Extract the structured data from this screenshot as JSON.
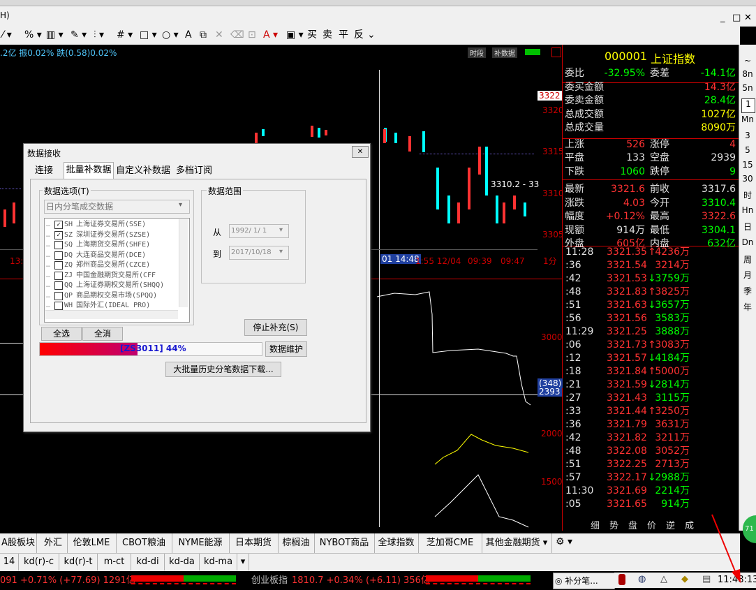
{
  "menubar": {
    "menu_fragment": "H)",
    "min_btn": "_",
    "restore_btn": "□",
    "close_btn": "✕"
  },
  "toolbar": {
    "icons": [
      "line-icon",
      "percent-icon",
      "grid-icon",
      "pen-icon",
      "align-icon",
      "hash-icon",
      "rect-icon",
      "circle-icon",
      "text-A-icon",
      "copy-icon",
      "delete-icon",
      "trash-icon",
      "font-color-icon",
      "save-icon"
    ],
    "buy_label": "买",
    "sell_label": "卖",
    "flat_label": "平",
    "reverse_label": "反",
    "more": "⌄"
  },
  "chart": {
    "header_text": ".2亿 振0.02% 跌(0.58)0.02%",
    "btn_time": "时段",
    "btn_fill": "补数据",
    "price_axis": [
      "3320",
      "3315",
      "3310",
      "3305"
    ],
    "price_tag": "3322",
    "annotation": "3310.2 - 33",
    "time_labels": [
      "13:",
      "01 14:48",
      "1:55 12/04",
      "09:39",
      "09:47",
      "1分"
    ],
    "vol_axis": [
      "3000",
      "2000",
      "1500"
    ],
    "vol_tag_top": "(348)",
    "vol_tag_bottom": "2393"
  },
  "quote": {
    "code": "000001",
    "name": "上证指数",
    "rows": [
      {
        "l1": "委比",
        "v1": "-32.95%",
        "l2": "委差",
        "v2": "-14.1亿",
        "c1": "#00ff00",
        "c2": "#00ff00"
      },
      {
        "l1": "委买金额",
        "v1": "",
        "l2": "",
        "v2": "14.3亿",
        "c1": "#ff3232",
        "c2": "#ff3232"
      },
      {
        "l1": "委卖金额",
        "v1": "",
        "l2": "",
        "v2": "28.4亿",
        "c1": "#00ff00",
        "c2": "#00ff00"
      },
      {
        "l1": "总成交额",
        "v1": "",
        "l2": "",
        "v2": "1027亿",
        "c1": "#ffff00",
        "c2": "#ffff00"
      },
      {
        "l1": "总成交量",
        "v1": "",
        "l2": "",
        "v2": "8090万",
        "c1": "#ffff00",
        "c2": "#ffff00"
      },
      {
        "l1": "上涨",
        "v1": "526",
        "l2": "涨停",
        "v2": "4",
        "c1": "#ff3232",
        "c2": "#ff3232"
      },
      {
        "l1": "平盘",
        "v1": "133",
        "l2": "空盘",
        "v2": "2939",
        "c1": "#e0e0e0",
        "c2": "#e0e0e0"
      },
      {
        "l1": "下跌",
        "v1": "1060",
        "l2": "跌停",
        "v2": "9",
        "c1": "#00ff00",
        "c2": "#00ff00"
      },
      {
        "l1": "最新",
        "v1": "3321.6",
        "l2": "前收",
        "v2": "3317.6",
        "c1": "#ff3232",
        "c2": "#e0e0e0"
      },
      {
        "l1": "涨跌",
        "v1": "4.03",
        "l2": "今开",
        "v2": "3310.4",
        "c1": "#ff3232",
        "c2": "#00ff00"
      },
      {
        "l1": "幅度",
        "v1": "+0.12%",
        "l2": "最高",
        "v2": "3322.6",
        "c1": "#ff3232",
        "c2": "#ff3232"
      },
      {
        "l1": "现额",
        "v1": "914万",
        "l2": "最低",
        "v2": "3304.1",
        "c1": "#e0e0e0",
        "c2": "#00ff00"
      },
      {
        "l1": "外盘",
        "v1": "605亿",
        "l2": "内盘",
        "v2": "632亿",
        "c1": "#ff3232",
        "c2": "#00ff00"
      }
    ],
    "ticks": [
      {
        "t": "11:28",
        "p": "3321.35",
        "a": "↑",
        "v": "4236万",
        "ac": "#ff3232",
        "vc": "#ff3232"
      },
      {
        "t": ":36",
        "p": "3321.54",
        "a": "",
        "v": "3214万",
        "ac": "#ff3232",
        "vc": "#ff3232"
      },
      {
        "t": ":42",
        "p": "3321.53",
        "a": "↓",
        "v": "3759万",
        "ac": "#00ff00",
        "vc": "#00ff00"
      },
      {
        "t": ":48",
        "p": "3321.83",
        "a": "↑",
        "v": "3825万",
        "ac": "#ff3232",
        "vc": "#ff3232"
      },
      {
        "t": ":51",
        "p": "3321.63",
        "a": "↓",
        "v": "3657万",
        "ac": "#00ff00",
        "vc": "#00ff00"
      },
      {
        "t": ":56",
        "p": "3321.56",
        "a": "",
        "v": "3583万",
        "ac": "#00ff00",
        "vc": "#00ff00"
      },
      {
        "t": "11:29",
        "p": "3321.25",
        "a": "",
        "v": "3888万",
        "ac": "#00ff00",
        "vc": "#00ff00"
      },
      {
        "t": ":06",
        "p": "3321.73",
        "a": "↑",
        "v": "3083万",
        "ac": "#ff3232",
        "vc": "#ff3232"
      },
      {
        "t": ":12",
        "p": "3321.57",
        "a": "↓",
        "v": "4184万",
        "ac": "#00ff00",
        "vc": "#00ff00"
      },
      {
        "t": ":18",
        "p": "3321.84",
        "a": "↑",
        "v": "5000万",
        "ac": "#ff3232",
        "vc": "#ff3232"
      },
      {
        "t": ":21",
        "p": "3321.59",
        "a": "↓",
        "v": "2814万",
        "ac": "#00ff00",
        "vc": "#00ff00"
      },
      {
        "t": ":27",
        "p": "3321.43",
        "a": "",
        "v": "3115万",
        "ac": "#00ff00",
        "vc": "#00ff00"
      },
      {
        "t": ":33",
        "p": "3321.44",
        "a": "↑",
        "v": "3250万",
        "ac": "#ff3232",
        "vc": "#ff3232"
      },
      {
        "t": ":36",
        "p": "3321.79",
        "a": "",
        "v": "3631万",
        "ac": "#ff3232",
        "vc": "#ff3232"
      },
      {
        "t": ":42",
        "p": "3321.82",
        "a": "",
        "v": "3211万",
        "ac": "#ff3232",
        "vc": "#ff3232"
      },
      {
        "t": ":48",
        "p": "3322.08",
        "a": "",
        "v": "3052万",
        "ac": "#ff3232",
        "vc": "#ff3232"
      },
      {
        "t": ":51",
        "p": "3322.25",
        "a": "",
        "v": "2713万",
        "ac": "#ff3232",
        "vc": "#ff3232"
      },
      {
        "t": ":57",
        "p": "3322.17",
        "a": "↓",
        "v": "2988万",
        "ac": "#00ff00",
        "vc": "#00ff00"
      },
      {
        "t": "11:30",
        "p": "3321.69",
        "a": "",
        "v": "2214万",
        "ac": "#00ff00",
        "vc": "#00ff00"
      },
      {
        "t": ":05",
        "p": "3321.65",
        "a": "",
        "v": "914万",
        "ac": "#00ff00",
        "vc": "#00ff00"
      }
    ],
    "footer_tabs": [
      "细",
      "势",
      "盘",
      "价",
      "逆",
      "成"
    ]
  },
  "right_sidebar": [
    "~",
    "8n",
    "5n",
    "1",
    "Mn",
    "3",
    "5",
    "15",
    "30",
    "时",
    "Hn",
    "日",
    "Dn",
    "周",
    "月",
    "季",
    "年"
  ],
  "tabs_row1": [
    "A股板块",
    "外汇",
    "伦敦LME",
    "CBOT粮油",
    "NYME能源",
    "日本期货",
    "棕榈油",
    "NYBOT商品",
    "全球指数",
    "芝加哥CME",
    "其他金融期货 ▾"
  ],
  "tabs_row2": [
    "14",
    "kd(r)-c",
    "kd(r)-t",
    "m-ct",
    "kd-di",
    "kd-da",
    "kd-ma",
    "▾"
  ],
  "status": {
    "left_idx": "091 +0.71% (+77.69) 1291亿",
    "mid_name": "创业板指",
    "mid_vals": "1810.7 +0.34% (+6.11) 356亿",
    "task": "◎ 补分笔...",
    "clock": "11:48:13",
    "badge": "71"
  },
  "dialog": {
    "title": "数据接收",
    "close": "✕",
    "tabs": [
      "连接",
      "批量补数据",
      "自定义补数据",
      "多档订阅"
    ],
    "group_options": "数据选项(T)",
    "data_type": "日内分笔成交数据",
    "list": [
      {
        "code": "SH",
        "name": "上海证券交易所(SSE)",
        "checked": true
      },
      {
        "code": "SZ",
        "name": "深圳证券交易所(SZSE)",
        "checked": true
      },
      {
        "code": "SQ",
        "name": "上海期货交易所(SHFE)",
        "checked": false
      },
      {
        "code": "DQ",
        "name": "大连商品交易所(DCE)",
        "checked": false
      },
      {
        "code": "ZQ",
        "name": "郑州商品交易所(CZCE)",
        "checked": false
      },
      {
        "code": "ZJ",
        "name": "中国金融期货交易所(CFF",
        "checked": false
      },
      {
        "code": "QQ",
        "name": "上海证券期权交易所(SHQQ)",
        "checked": false
      },
      {
        "code": "QP",
        "name": "商品期权交易市场(SPQQ)",
        "checked": false
      },
      {
        "code": "WH",
        "name": "国际外汇(IDEAL PRO)",
        "checked": false
      }
    ],
    "group_range": "数据范围",
    "from_label": "从",
    "from_date": "1992/ 1/ 1",
    "to_label": "到",
    "to_date": "2017/10/18",
    "btn_select_all": "全选",
    "btn_clear": "全消",
    "btn_stop": "停止补充(S)",
    "progress_text": "[ZS3011] 44%",
    "progress": 0.44,
    "btn_maintain": "数据维护",
    "btn_bulk": "大批量历史分笔数据下载..."
  }
}
